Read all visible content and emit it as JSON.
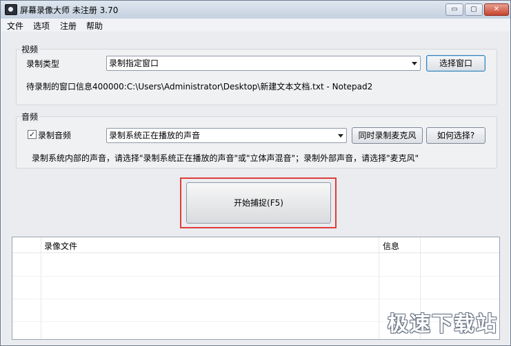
{
  "window": {
    "title": "屏幕录像大师 未注册 3.70",
    "min_glyph": "▭",
    "max_glyph": "▢",
    "close_glyph": "✕"
  },
  "menu": [
    {
      "label": "文件"
    },
    {
      "label": "选项"
    },
    {
      "label": "注册"
    },
    {
      "label": "帮助"
    }
  ],
  "video": {
    "group_label": "视频",
    "type_label": "录制类型",
    "type_value": "录制指定窗口",
    "select_window_button": "选择窗口",
    "info_text": "待录制的窗口信息400000:C:\\Users\\Administrator\\Desktop\\新建文本文档.txt - Notepad2"
  },
  "audio": {
    "group_label": "音频",
    "record_audio_checked": true,
    "record_audio_label": "录制音频",
    "check_glyph": "✓",
    "source_value": "录制系统正在播放的声音",
    "mic_button": "同时录制麦克风",
    "how_button": "如何选择?",
    "hint_text": "录制系统内部的声音，请选择\"录制系统正在播放的声音\"或\"立体声混音\"；录制外部声音，请选择\"麦克风\""
  },
  "capture": {
    "start_button": "开始捕捉(F5)",
    "highlight_color": "#e03b3b"
  },
  "table": {
    "columns": [
      "",
      "录像文件",
      "信息",
      ""
    ],
    "rows": []
  },
  "watermark": "极速下载站"
}
